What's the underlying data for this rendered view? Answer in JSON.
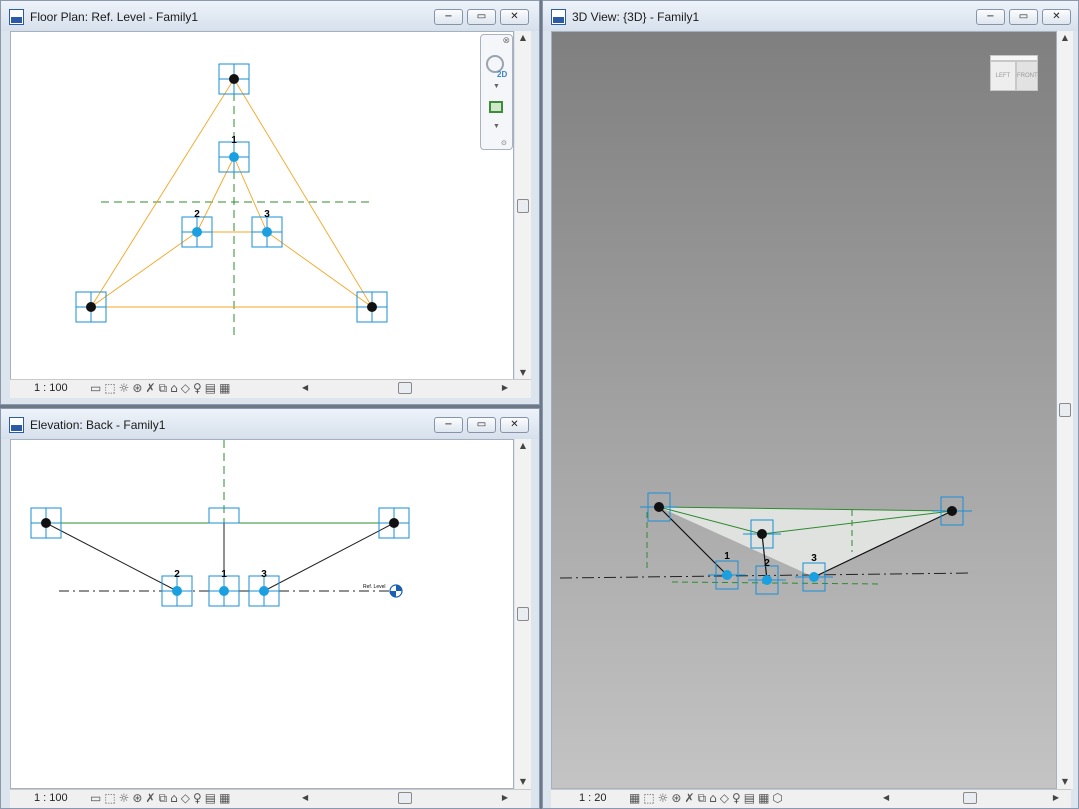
{
  "windows": {
    "floor_plan": {
      "title": "Floor Plan: Ref. Level - Family1",
      "scale": "1 : 100",
      "point_labels": [
        "1",
        "2",
        "3"
      ]
    },
    "elevation": {
      "title": "Elevation: Back - Family1",
      "scale": "1 : 100",
      "point_labels": [
        "2",
        "1",
        "3"
      ],
      "level_tag": "Ref. Level"
    },
    "view3d": {
      "title": "3D View: {3D} - Family1",
      "scale": "1 : 20",
      "point_labels": [
        "1",
        "2",
        "3"
      ],
      "viewcube": {
        "left": "LEFT",
        "front": "FRONT"
      }
    }
  },
  "window_controls": {
    "minimize": "−",
    "restore": "▭",
    "close": "✕"
  },
  "navigation_bar": {
    "label_2d": "2D"
  },
  "icons": {
    "view_control": [
      "detail-level-icon",
      "visual-style-icon",
      "sun-path-icon",
      "shadows-icon",
      "crop-view-icon",
      "show-crop-icon",
      "temporary-hide-icon",
      "reveal-hidden-icon",
      "analysis-icon",
      "highlight-icon"
    ],
    "window": "revit-document-icon"
  },
  "colors": {
    "reference_line": "#f5a623",
    "work_plane": "#2e8b2e",
    "point_blue": "#1a9fe0",
    "point_black": "#111111",
    "frame_blue": "#1a8fd6",
    "view3d_bg_top": "#7f7f7f",
    "view3d_bg_bottom": "#c4c4c4"
  }
}
